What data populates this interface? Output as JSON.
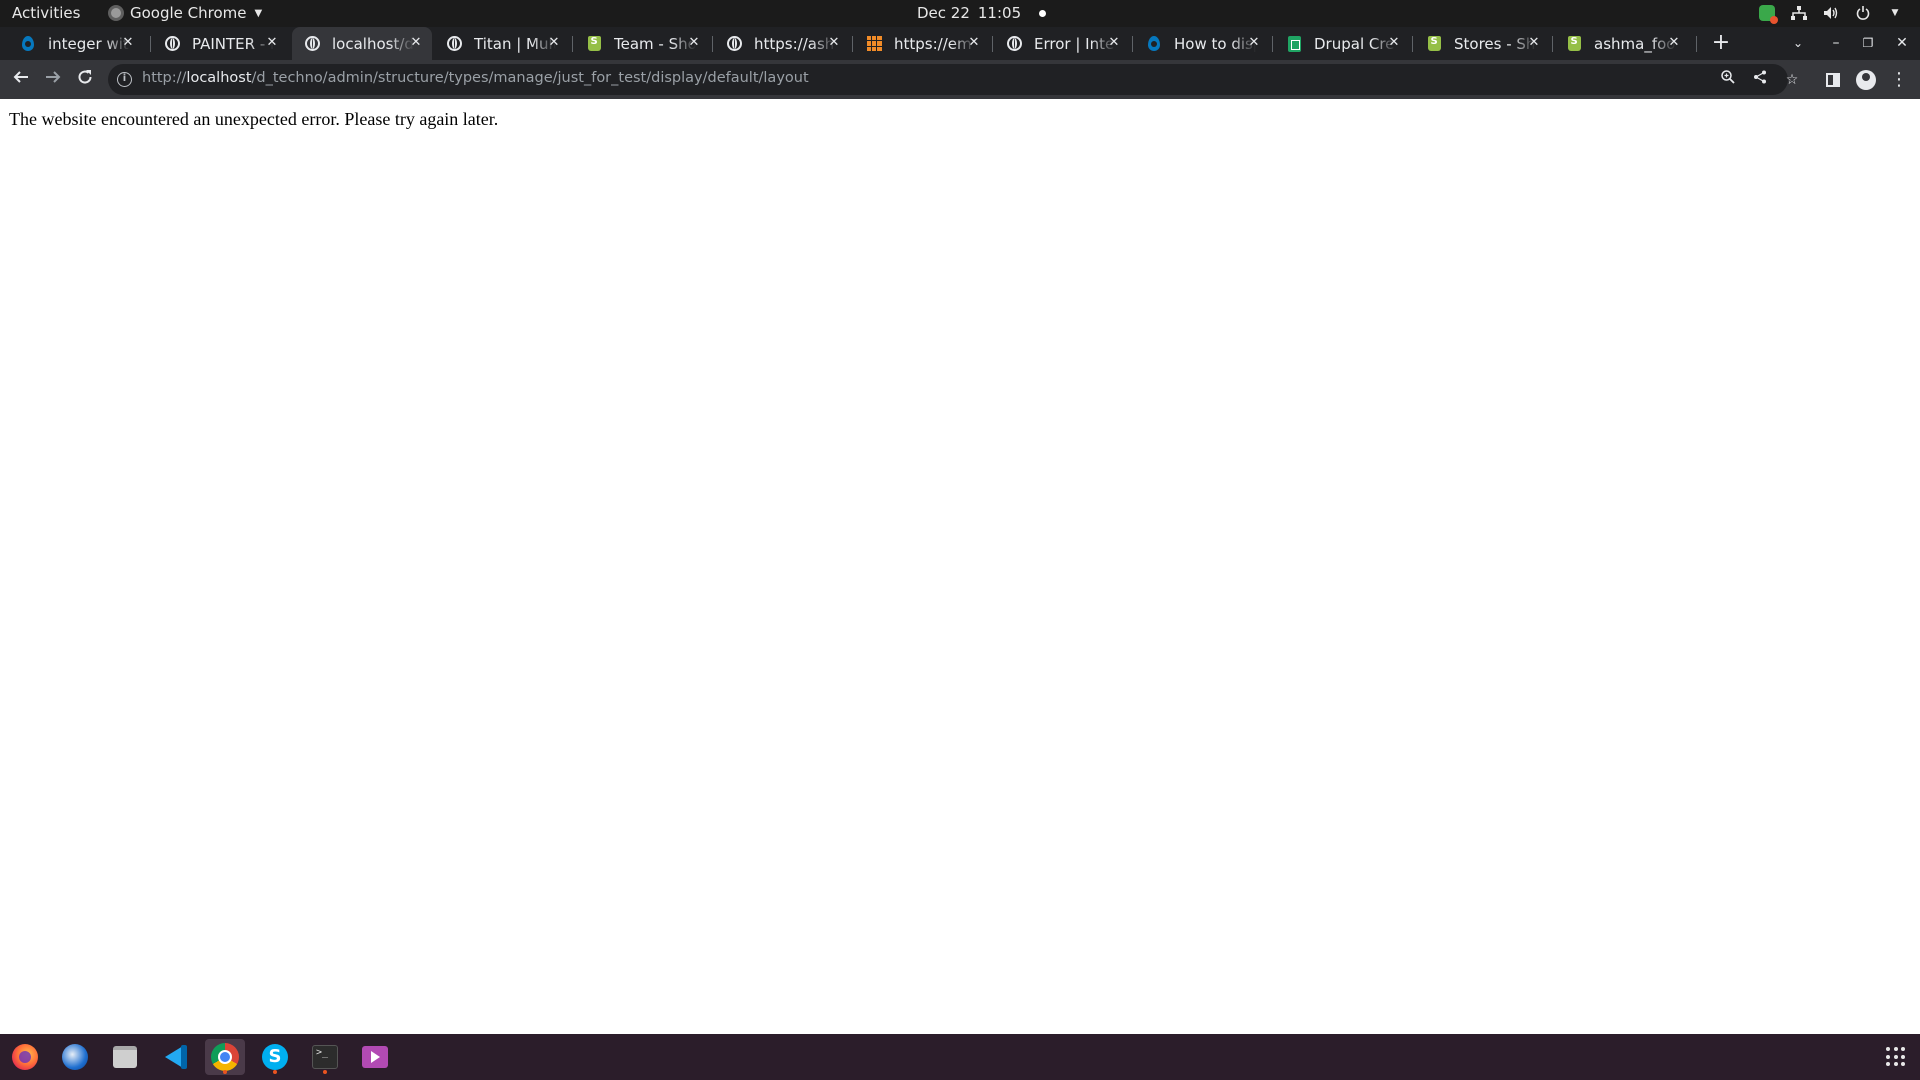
{
  "topbar": {
    "activities": "Activities",
    "app_name": "Google Chrome",
    "date": "Dec 22",
    "time": "11:05"
  },
  "tabs": [
    {
      "title": "integer with",
      "icon": "drupal-icon",
      "active": false
    },
    {
      "title": "PAINTER - F",
      "icon": "globe-icon",
      "active": false
    },
    {
      "title": "localhost/d",
      "icon": "globe-icon",
      "active": true
    },
    {
      "title": "Titan | Multi",
      "icon": "globe-icon",
      "active": false
    },
    {
      "title": "Team - Shop",
      "icon": "shopify-icon",
      "active": false
    },
    {
      "title": "https://ash",
      "icon": "globe-icon",
      "active": false
    },
    {
      "title": "https://em",
      "icon": "grid-icon",
      "active": false
    },
    {
      "title": "Error | Inter",
      "icon": "globe-icon",
      "active": false
    },
    {
      "title": "How to disp",
      "icon": "drupal-icon",
      "active": false
    },
    {
      "title": "Drupal Cre",
      "icon": "sheets-icon",
      "active": false
    },
    {
      "title": "Stores - Sh",
      "icon": "shopify-icon",
      "active": false
    },
    {
      "title": "ashma_foo",
      "icon": "shopify-icon",
      "active": false
    }
  ],
  "address": {
    "scheme": "http://",
    "host": "localhost",
    "path": "/d_techno/admin/structure/types/manage/just_for_test/display/default/layout"
  },
  "page": {
    "error_message": "The website encountered an unexpected error. Please try again later."
  },
  "dock": {
    "apps": [
      "firefox-icon",
      "thunderbird-icon",
      "files-icon",
      "vscode-icon",
      "chrome-icon",
      "skype-icon",
      "terminal-icon",
      "video-icon"
    ]
  },
  "colors": {
    "topbar_bg": "#1b1b1b",
    "tabstrip_bg": "#202124",
    "active_tab_bg": "#35363a",
    "dock_bg": "#2b1d2a",
    "accent_running": "#e95420"
  }
}
